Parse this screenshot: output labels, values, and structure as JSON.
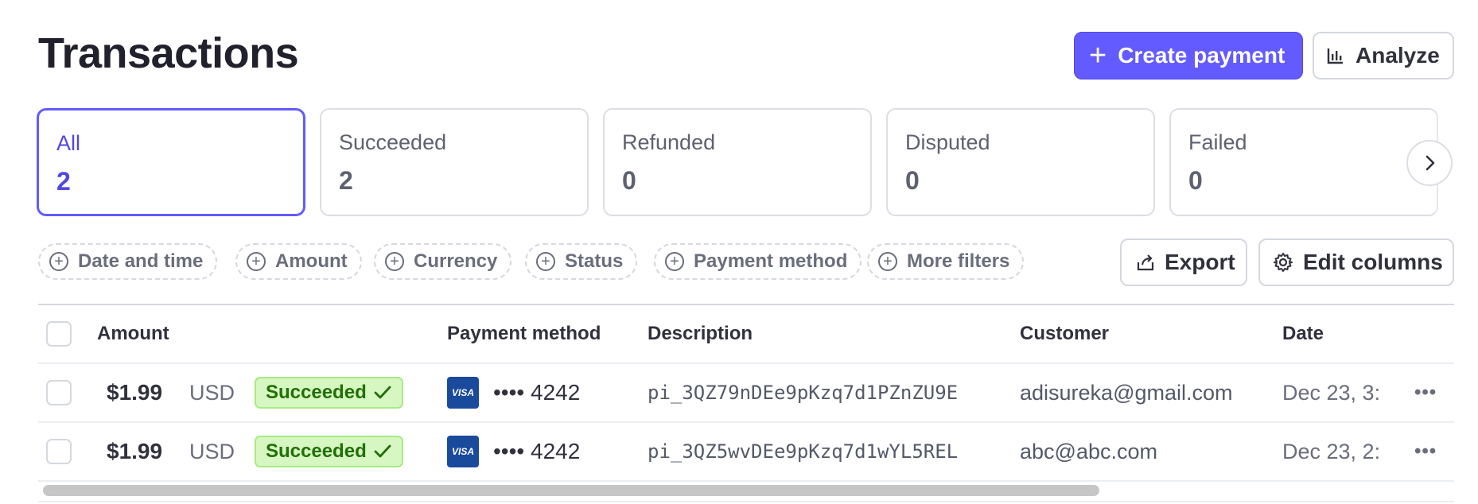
{
  "page": {
    "title": "Transactions"
  },
  "header": {
    "create_payment": "Create payment",
    "analyze": "Analyze"
  },
  "status_tabs": [
    {
      "label": "All",
      "count": "2",
      "active": true
    },
    {
      "label": "Succeeded",
      "count": "2",
      "active": false
    },
    {
      "label": "Refunded",
      "count": "0",
      "active": false
    },
    {
      "label": "Disputed",
      "count": "0",
      "active": false
    },
    {
      "label": "Failed",
      "count": "0",
      "active": false
    }
  ],
  "filters": [
    "Date and time",
    "Amount",
    "Currency",
    "Status",
    "Payment method",
    "More filters"
  ],
  "toolbar": {
    "export": "Export",
    "edit_columns": "Edit columns"
  },
  "table": {
    "columns": [
      "Amount",
      "Payment method",
      "Description",
      "Customer",
      "Date"
    ],
    "rows": [
      {
        "amount": "$1.99",
        "currency": "USD",
        "status": "Succeeded",
        "card_brand": "VISA",
        "card_last4": "•••• 4242",
        "description": "pi_3QZ79nDEe9pKzq7d1PZnZU9E",
        "customer": "adisureka@gmail.com",
        "date": "Dec 23, 3:"
      },
      {
        "amount": "$1.99",
        "currency": "USD",
        "status": "Succeeded",
        "card_brand": "VISA",
        "card_last4": "•••• 4242",
        "description": "pi_3QZ5wvDEe9pKzq7d1wYL5REL",
        "customer": "abc@abc.com",
        "date": "Dec 23, 2:"
      }
    ],
    "row_menu": "•••"
  },
  "colors": {
    "accent": "#635bff",
    "success_bg": "#d7f7c2",
    "success_text": "#217005",
    "visa": "#1a4a9c"
  },
  "icons": [
    "plus-icon",
    "bar-chart-icon",
    "chevron-right-icon",
    "circle-plus-icon",
    "export-icon",
    "gear-icon",
    "checkmark-icon",
    "visa-icon",
    "more-icon"
  ]
}
